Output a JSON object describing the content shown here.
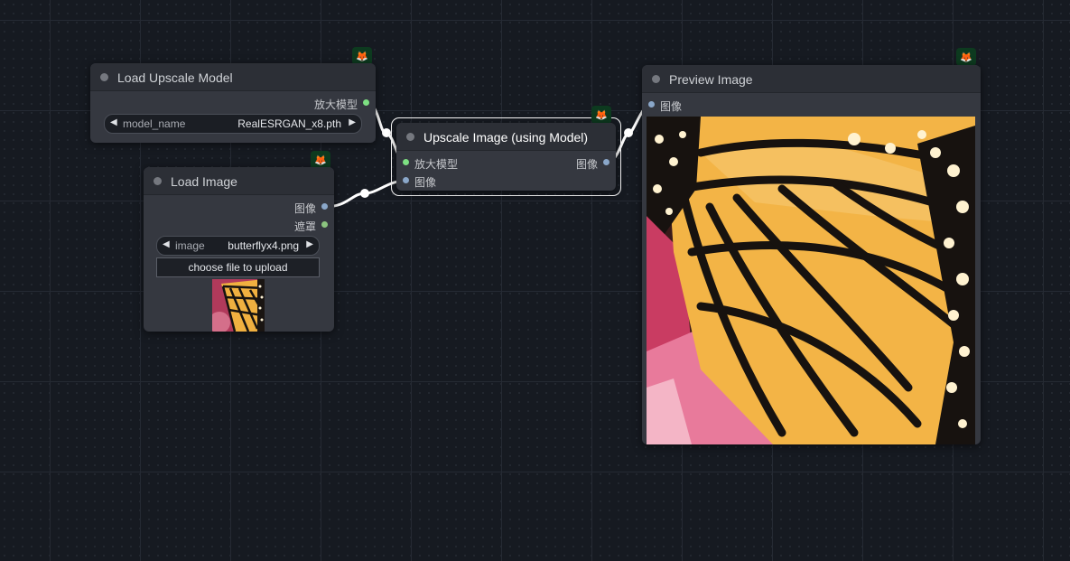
{
  "nodes": {
    "load_upscale_model": {
      "title": "Load Upscale Model",
      "output_label": "放大模型",
      "widget": {
        "name": "model_name",
        "value": "RealESRGAN_x8.pth"
      }
    },
    "load_image": {
      "title": "Load Image",
      "outputs": [
        "图像",
        "遮罩"
      ],
      "widget": {
        "name": "image",
        "value": "butterflyx4.png"
      },
      "upload_label": "choose file to upload"
    },
    "upscale_image": {
      "title": "Upscale Image (using Model)",
      "inputs": [
        "放大模型",
        "图像"
      ],
      "output_label": "图像"
    },
    "preview_image": {
      "title": "Preview Image",
      "input_label": "图像"
    }
  },
  "colors": {
    "canvas_bg": "#161a21",
    "node_body": "#353840",
    "node_header": "#2c2f36",
    "slot_upscale_model": "#7de082",
    "slot_image": "#8aa7c9",
    "slot_mask": "#8bc47f",
    "badge_bg": "#0d3a1f",
    "selection_outline": "#ffffff"
  },
  "icons": {
    "node_badge": "fox-icon",
    "widget_left": "triangle-left-icon",
    "widget_right": "triangle-right-icon"
  }
}
